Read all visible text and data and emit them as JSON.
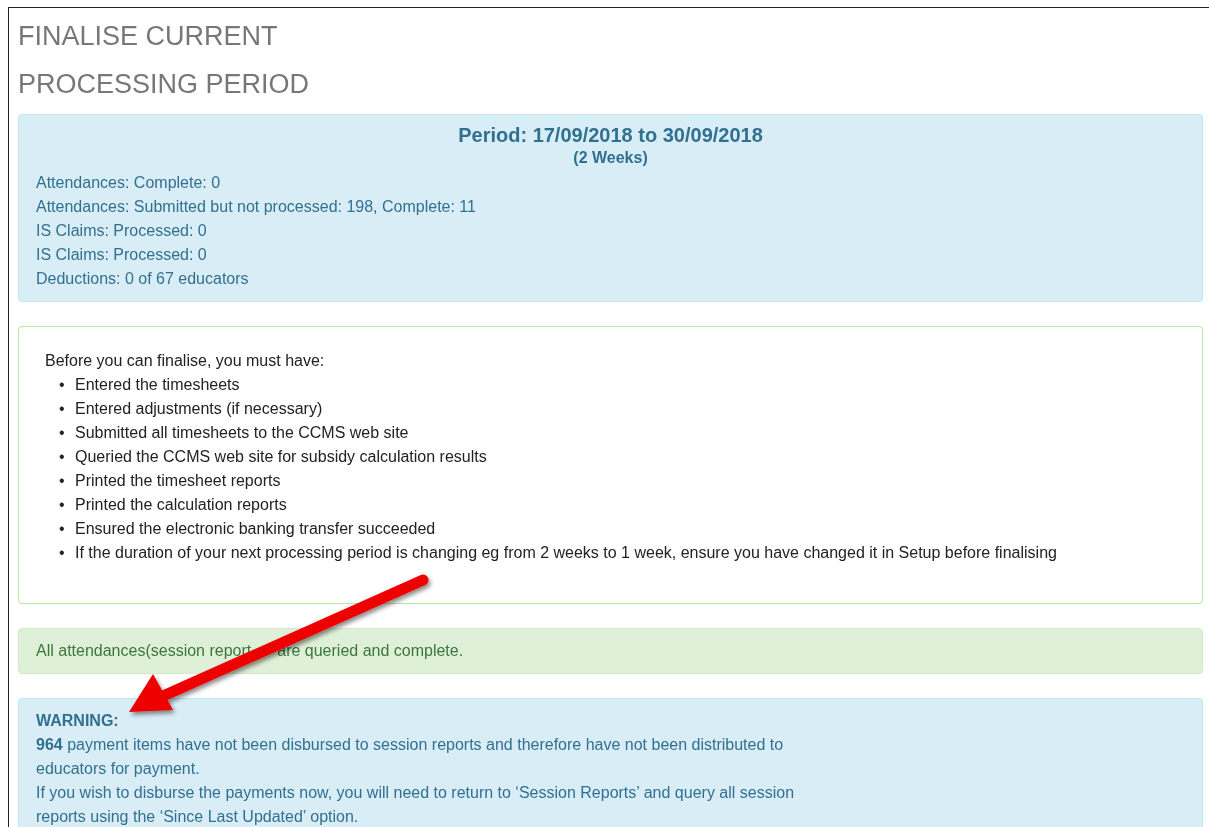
{
  "title_lines": [
    "FINALISE CURRENT",
    "PROCESSING PERIOD"
  ],
  "period_panel": {
    "heading": "Period: 17/09/2018 to 30/09/2018",
    "subheading": "(2 Weeks)",
    "lines": [
      "Attendances: Complete: 0",
      "Attendances: Submitted but not processed: 198, Complete: 11",
      "IS Claims: Processed: 0",
      "IS Claims: Processed: 0",
      "Deductions: 0 of 67 educators"
    ]
  },
  "requirements_panel": {
    "intro": "Before you can finalise, you must have:",
    "items": [
      {
        "bullet": "•",
        "text": "Entered the timesheets"
      },
      {
        "bullet": "•",
        "text": "Entered adjustments (if necessary)"
      },
      {
        "bullet": "•",
        "text": "Submitted all timesheets to the CCMS web site"
      },
      {
        "bullet": "•",
        "text": "Queried the CCMS web site for subsidy calculation results"
      },
      {
        "bullet": "•",
        "text": "Printed the timesheet reports"
      },
      {
        "bullet": "•",
        "text": "Printed the calculation reports"
      },
      {
        "bullet": "•",
        "text": "Ensured the electronic banking transfer succeeded"
      },
      {
        "bullet": "•",
        "text": "If the duration of your next processing period is changing eg from 2 weeks to 1 week, ensure you have changed it in Setup before finalising"
      }
    ]
  },
  "alerts": [
    {
      "kind": "success",
      "segments": [
        "All attendances(session report",
        "are queried and complete."
      ]
    },
    {
      "kind": "info",
      "heading": "WARNING:",
      "lines": [
        "**964** payment items have not been disbursed to session reports and therefore have not been distributed to educators for payment.",
        "If you wish to disburse the payments now, you will need to return to ‘Session Reports’ and query all session reports using the ‘Since Last Updated’ option."
      ]
    }
  ]
}
